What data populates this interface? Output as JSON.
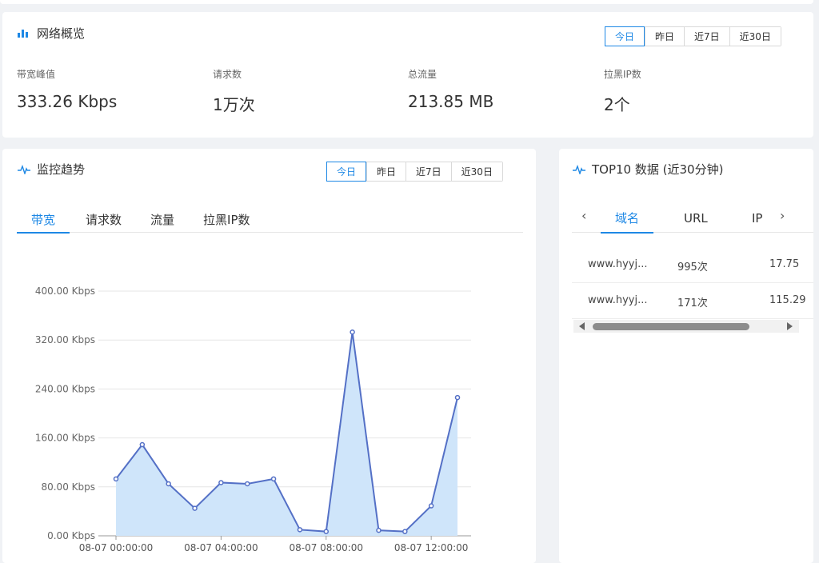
{
  "overview": {
    "title": "网络概览",
    "ranges": [
      "今日",
      "昨日",
      "近7日",
      "近30日"
    ],
    "active_range": 0,
    "stats": [
      {
        "label": "带宽峰值",
        "value": "333.26 Kbps"
      },
      {
        "label": "请求数",
        "value": "1万次"
      },
      {
        "label": "总流量",
        "value": "213.85 MB"
      },
      {
        "label": "拉黑IP数",
        "value": "2个"
      }
    ]
  },
  "trend": {
    "title": "监控趋势",
    "ranges": [
      "今日",
      "昨日",
      "近7日",
      "近30日"
    ],
    "active_range": 0,
    "tabs": [
      "带宽",
      "请求数",
      "流量",
      "拉黑IP数"
    ],
    "active_tab": 0
  },
  "top10": {
    "title": "TOP10 数据 (近30分钟)",
    "tabs": [
      "域名",
      "URL",
      "IP"
    ],
    "active_tab": 0,
    "prev_icon": "‹",
    "next_icon": "›",
    "rows": [
      {
        "domain": "www.hyyj...",
        "count": "995次",
        "traffic": "17.75"
      },
      {
        "domain": "www.hyyj...",
        "count": "171次",
        "traffic": "115.29"
      }
    ]
  },
  "colors": {
    "accent": "#1e88e5",
    "line": "#5470c6",
    "area": "#cfe5fa"
  },
  "chart_data": {
    "type": "area",
    "ylim": [
      0,
      400
    ],
    "yticks": [
      "0.00 Kbps",
      "80.00 Kbps",
      "160.00 Kbps",
      "240.00 Kbps",
      "320.00 Kbps",
      "400.00 Kbps"
    ],
    "xticks": [
      "08-07 00:00:00",
      "08-07 04:00:00",
      "08-07 08:00:00",
      "08-07 12:00:00"
    ],
    "x": [
      "08-07 00:00:00",
      "08-07 01:00:00",
      "08-07 02:00:00",
      "08-07 03:00:00",
      "08-07 04:00:00",
      "08-07 05:00:00",
      "08-07 06:00:00",
      "08-07 07:00:00",
      "08-07 08:00:00",
      "08-07 09:00:00",
      "08-07 10:00:00",
      "08-07 11:00:00",
      "08-07 12:00:00",
      "08-07 13:00:00"
    ],
    "values": [
      93,
      149,
      85,
      45,
      87,
      85,
      93,
      10,
      7,
      333,
      9,
      7,
      49,
      226
    ],
    "grid": true
  }
}
